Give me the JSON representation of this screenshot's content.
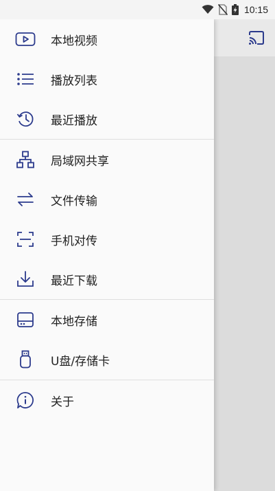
{
  "status_bar": {
    "time": "10:15"
  },
  "colors": {
    "icon": "#2b3a8c",
    "text": "#222222"
  },
  "drawer": {
    "groups": [
      {
        "items": [
          {
            "label": "本地视频",
            "icon": "play-video-icon"
          },
          {
            "label": "播放列表",
            "icon": "list-icon"
          },
          {
            "label": "最近播放",
            "icon": "history-icon"
          }
        ]
      },
      {
        "items": [
          {
            "label": "局域网共享",
            "icon": "network-icon"
          },
          {
            "label": "文件传输",
            "icon": "transfer-arrows-icon"
          },
          {
            "label": "手机对传",
            "icon": "scan-icon"
          },
          {
            "label": "最近下载",
            "icon": "download-icon"
          }
        ]
      },
      {
        "items": [
          {
            "label": "本地存储",
            "icon": "storage-drive-icon"
          },
          {
            "label": "U盘/存储卡",
            "icon": "usb-icon"
          }
        ]
      },
      {
        "items": [
          {
            "label": "关于",
            "icon": "info-chat-icon"
          }
        ]
      }
    ]
  }
}
